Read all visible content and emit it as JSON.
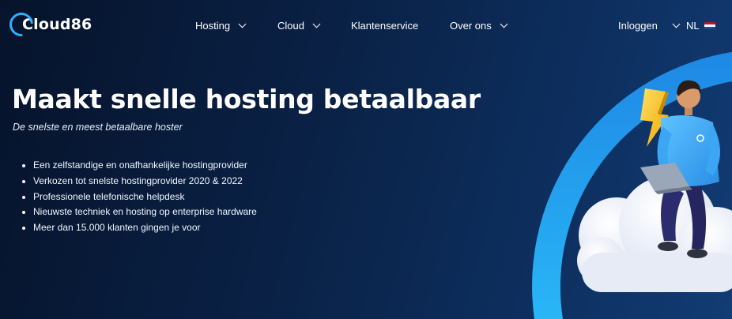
{
  "brand": {
    "logo_text": "Cloud86",
    "accent": "#2fb1ff"
  },
  "nav": {
    "items": [
      {
        "label": "Hosting",
        "has_dropdown": true
      },
      {
        "label": "Cloud",
        "has_dropdown": true
      },
      {
        "label": "Klantenservice",
        "has_dropdown": false
      },
      {
        "label": "Over ons",
        "has_dropdown": true
      }
    ],
    "login": "Inloggen",
    "language": "NL"
  },
  "hero": {
    "title": "Maakt snelle hosting betaalbaar",
    "subtitle": "De snelste en meest betaalbare hoster",
    "usps": [
      "Een zelfstandige en onafhankelijke hostingprovider",
      "Verkozen tot snelste hostingprovider 2020 & 2022",
      "Professionele telefonische helpdesk",
      "Nieuwste techniek en hosting op enterprise hardware",
      "Meer dan 15.000 klanten gingen je voor"
    ]
  },
  "icons": [
    "chevron-down-icon",
    "netherlands-flag-icon",
    "lightning-icon",
    "laptop-icon"
  ],
  "colors": {
    "background_dark": "#06132b",
    "background_light": "#123c74",
    "arc_blue": "#2196f3",
    "lightning": "#f5c518"
  }
}
